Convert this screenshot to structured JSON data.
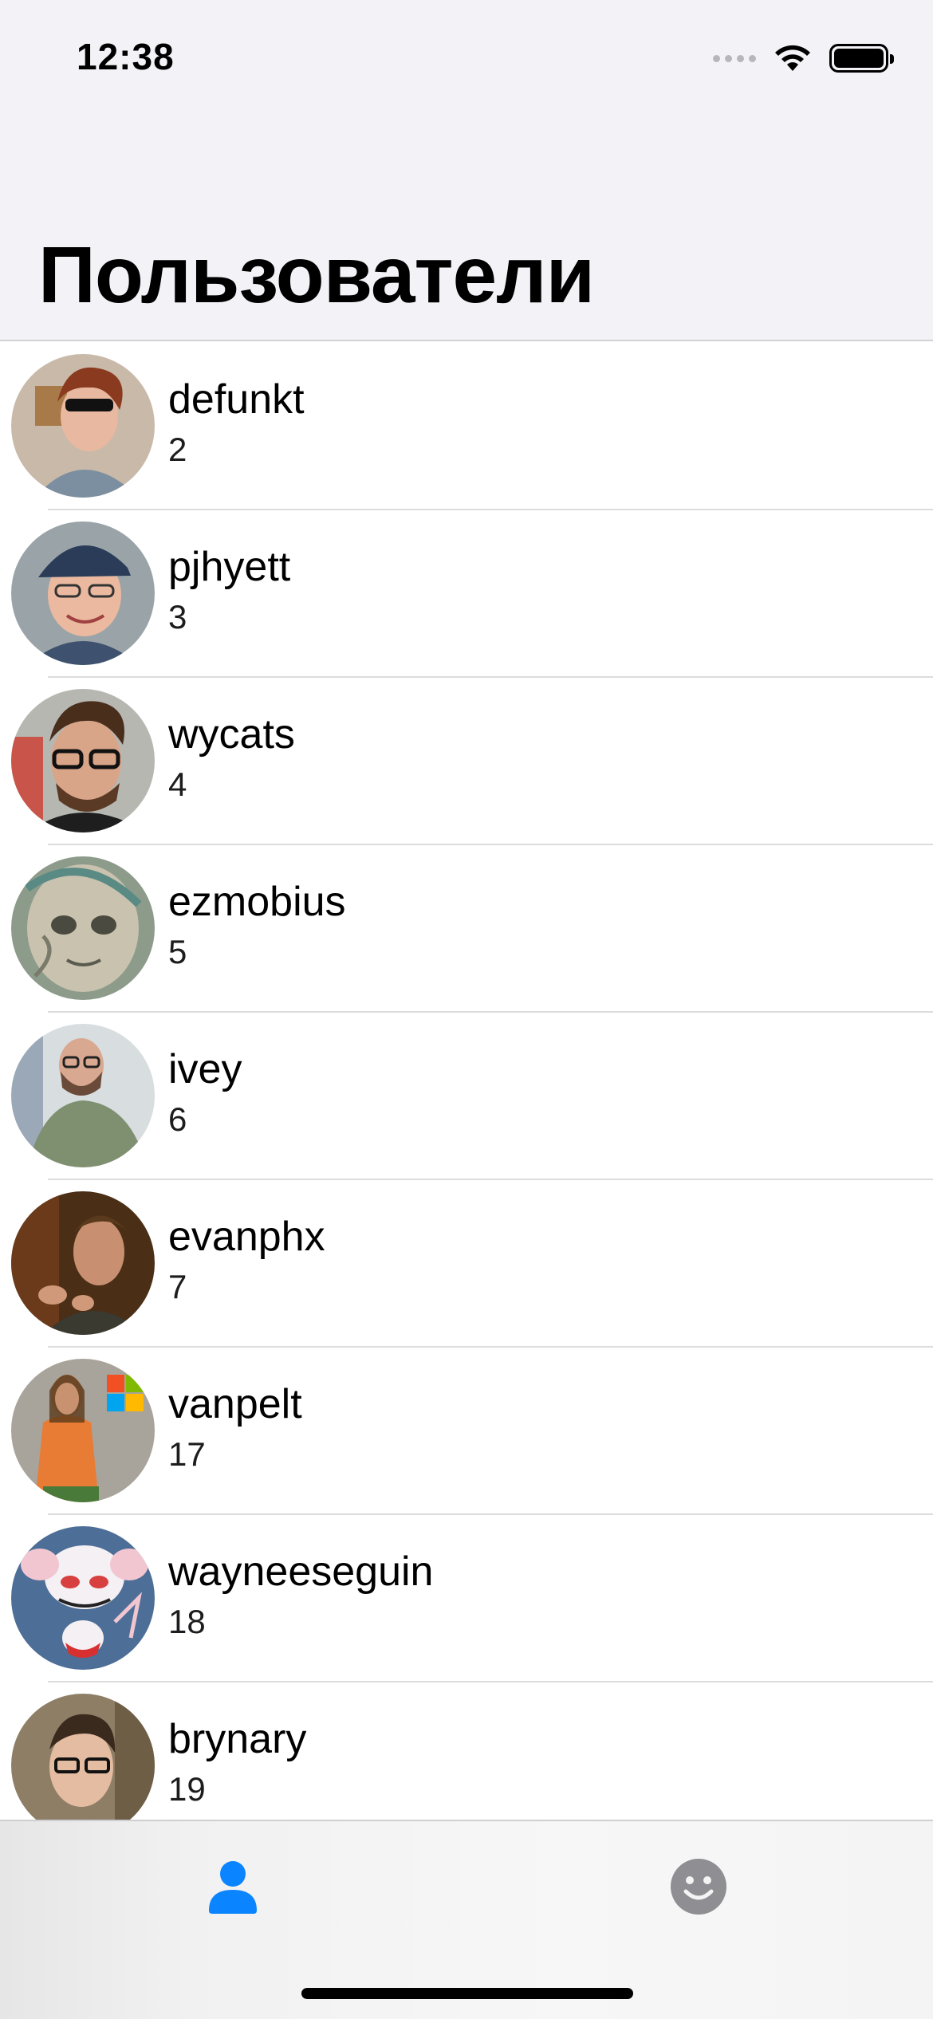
{
  "status_bar": {
    "time": "12:38"
  },
  "navigation": {
    "title": "Пользователи"
  },
  "users": [
    {
      "login": "defunkt",
      "id": "2"
    },
    {
      "login": "pjhyett",
      "id": "3"
    },
    {
      "login": "wycats",
      "id": "4"
    },
    {
      "login": "ezmobius",
      "id": "5"
    },
    {
      "login": "ivey",
      "id": "6"
    },
    {
      "login": "evanphx",
      "id": "7"
    },
    {
      "login": "vanpelt",
      "id": "17"
    },
    {
      "login": "wayneeseguin",
      "id": "18"
    },
    {
      "login": "brynary",
      "id": "19"
    }
  ],
  "tab_bar": {
    "items": [
      {
        "icon": "person-icon",
        "selected": true,
        "color": "#0a84ff"
      },
      {
        "icon": "smiley-face-icon",
        "selected": false,
        "color": "#8e8e93"
      }
    ]
  },
  "colors": {
    "accent": "#0a84ff",
    "header_bg": "#f2f2f7",
    "separator": "#dcdcdf"
  }
}
